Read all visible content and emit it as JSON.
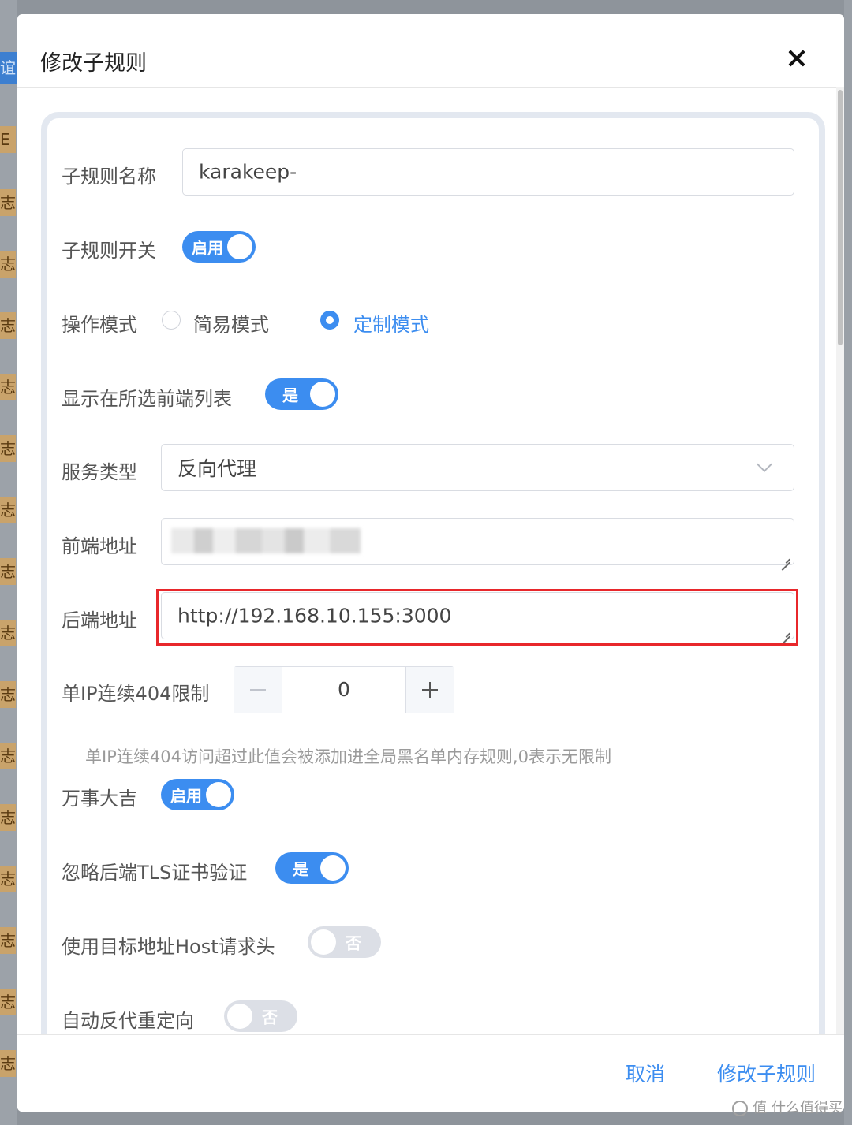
{
  "background": {
    "left_tags": [
      "谊",
      "E",
      "志",
      "志",
      "志",
      "志",
      "志",
      "志",
      "志",
      "志",
      "志",
      "志",
      "志",
      "志",
      "志",
      "志",
      "志"
    ]
  },
  "dialog": {
    "title": "修改子规则",
    "close_icon": "close-icon"
  },
  "form": {
    "rule_name": {
      "label": "子规则名称",
      "value": "karakeep-"
    },
    "rule_switch": {
      "label": "子规则开关",
      "text": "启用",
      "on": true
    },
    "mode": {
      "label": "操作模式",
      "options": [
        "简易模式",
        "定制模式"
      ],
      "selected": "定制模式"
    },
    "show_in_list": {
      "label": "显示在所选前端列表",
      "text": "是",
      "on": true
    },
    "service_type": {
      "label": "服务类型",
      "value": "反向代理"
    },
    "frontend_addr": {
      "label": "前端地址",
      "value": ""
    },
    "backend_addr": {
      "label": "后端地址",
      "value": "http://192.168.10.155:3000"
    },
    "limit_404": {
      "label": "单IP连续404限制",
      "value": "0",
      "hint": "单IP连续404访问超过此值会被添加进全局黑名单内存规则,0表示无限制"
    },
    "wanshi": {
      "label": "万事大吉",
      "text": "启用",
      "on": true
    },
    "ignore_tls": {
      "label": "忽略后端TLS证书验证",
      "text": "是",
      "on": true
    },
    "use_host": {
      "label": "使用目标地址Host请求头",
      "text": "否",
      "on": false
    },
    "auto_redirect": {
      "label": "自动反代重定向",
      "text": "否",
      "on": false
    }
  },
  "footer": {
    "cancel": "取消",
    "submit": "修改子规则"
  },
  "watermark": "值 什么值得买",
  "colors": {
    "accent": "#3c8df0",
    "highlight": "#e8272b"
  }
}
